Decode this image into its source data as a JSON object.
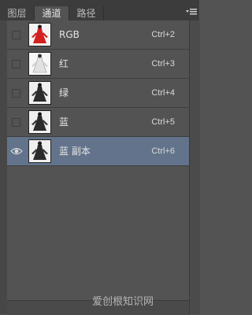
{
  "tabs": [
    {
      "label": "图层",
      "active": false
    },
    {
      "label": "通道",
      "active": true
    },
    {
      "label": "路径",
      "active": false
    }
  ],
  "panel_menu_icon": "panel-menu-icon",
  "channels": [
    {
      "name": "RGB",
      "shortcut": "Ctrl+2",
      "thumb": "color",
      "visible": false,
      "selected": false
    },
    {
      "name": "红",
      "shortcut": "Ctrl+3",
      "thumb": "light",
      "visible": false,
      "selected": false
    },
    {
      "name": "绿",
      "shortcut": "Ctrl+4",
      "thumb": "dark",
      "visible": false,
      "selected": false
    },
    {
      "name": "蓝",
      "shortcut": "Ctrl+5",
      "thumb": "dark",
      "visible": false,
      "selected": false
    },
    {
      "name": "蓝 副本",
      "shortcut": "Ctrl+6",
      "thumb": "dark",
      "visible": true,
      "selected": true
    }
  ],
  "watermark": "爱创根知识网",
  "colors": {
    "selected_row": "#62738b",
    "panel_bg": "#535353"
  }
}
